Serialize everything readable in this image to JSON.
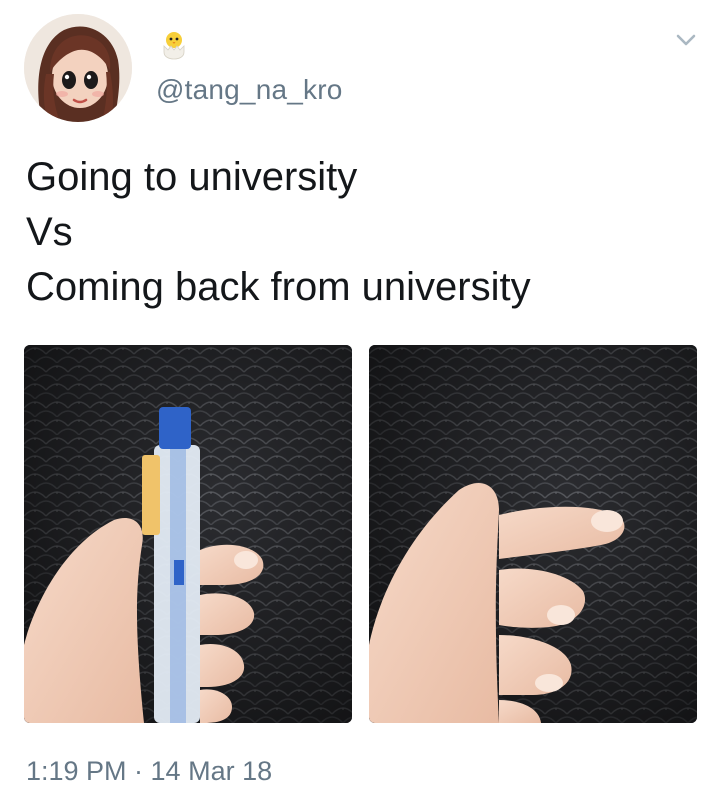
{
  "tweet": {
    "handle": "@tang_na_kro",
    "text_lines": [
      "Going to university",
      "Vs",
      "Coming back from university"
    ],
    "timestamp": "1:19 PM · 14 Mar 18"
  },
  "icons": {
    "name_emoji": "hatching-chick-icon",
    "menu": "chevron-down-icon",
    "avatar": "cartoon-girl-avatar"
  },
  "photos": [
    {
      "subject": "hand-holding-blue-pen"
    },
    {
      "subject": "hand-empty-pinch"
    }
  ],
  "colors": {
    "secondary_text": "#657786",
    "primary_text": "#14171a",
    "pen_blue": "#2f63c8"
  }
}
